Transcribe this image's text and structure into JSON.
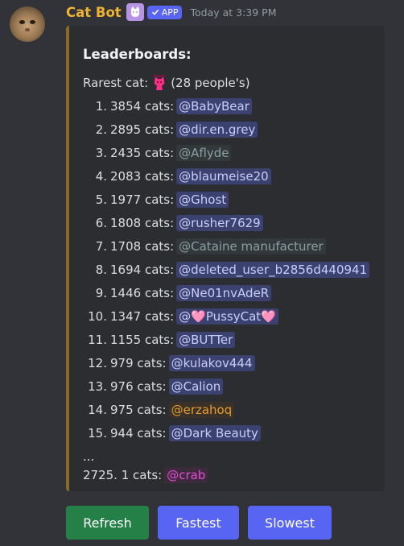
{
  "message": {
    "author": "Cat Bot",
    "badge": "APP",
    "timestamp": "Today at 3:39 PM",
    "role_icon": "cat-icon"
  },
  "embed": {
    "accent_color": "#8a6a2a",
    "title": "Leaderboards:",
    "rarest_prefix": "Rarest cat:",
    "rarest_icon": "pink-cat-icon",
    "rarest_suffix": "(28 people's)",
    "entries": [
      {
        "rank": "1.",
        "count": "3854 cats:",
        "user": "@BabyBear",
        "style": "blue"
      },
      {
        "rank": "2.",
        "count": "2895 cats:",
        "user": "@dir.en.grey",
        "style": "blue"
      },
      {
        "rank": "3.",
        "count": "2435 cats:",
        "user": "@Aflyde",
        "style": "grey"
      },
      {
        "rank": "4.",
        "count": "2083 cats:",
        "user": "@blaumeise20",
        "style": "blue"
      },
      {
        "rank": "5.",
        "count": "1977 cats:",
        "user": "@Ghost",
        "style": "blue"
      },
      {
        "rank": "6.",
        "count": "1808 cats:",
        "user": "@rusher7629",
        "style": "blue"
      },
      {
        "rank": "7.",
        "count": "1708 cats:",
        "user": "@Cataine manufacturer",
        "style": "grey"
      },
      {
        "rank": "8.",
        "count": "1694 cats:",
        "user": "@deleted_user_b2856d440941",
        "style": "blue"
      },
      {
        "rank": "9.",
        "count": "1446 cats:",
        "user": "@Ne01nvAdeR",
        "style": "blue"
      },
      {
        "rank": "10.",
        "count": "1347 cats:",
        "user": "@🩷PussyCat🩷",
        "style": "blue"
      },
      {
        "rank": "11.",
        "count": "1155 cats:",
        "user": "@BUTTer",
        "style": "blue"
      },
      {
        "rank": "12.",
        "count": "979 cats:",
        "user": "@kulakov444",
        "style": "blue"
      },
      {
        "rank": "13.",
        "count": "976 cats:",
        "user": "@Calion",
        "style": "blue"
      },
      {
        "rank": "14.",
        "count": "975 cats:",
        "user": "@erzahoq",
        "style": "orange"
      },
      {
        "rank": "15.",
        "count": "944 cats:",
        "user": "@Dark Beauty",
        "style": "blue"
      }
    ],
    "ellipsis": "...",
    "self_entry": {
      "count": "2725. 1 cats:",
      "user": "@crab",
      "style": "pink"
    }
  },
  "buttons": {
    "refresh": "Refresh",
    "fastest": "Fastest",
    "slowest": "Slowest"
  }
}
